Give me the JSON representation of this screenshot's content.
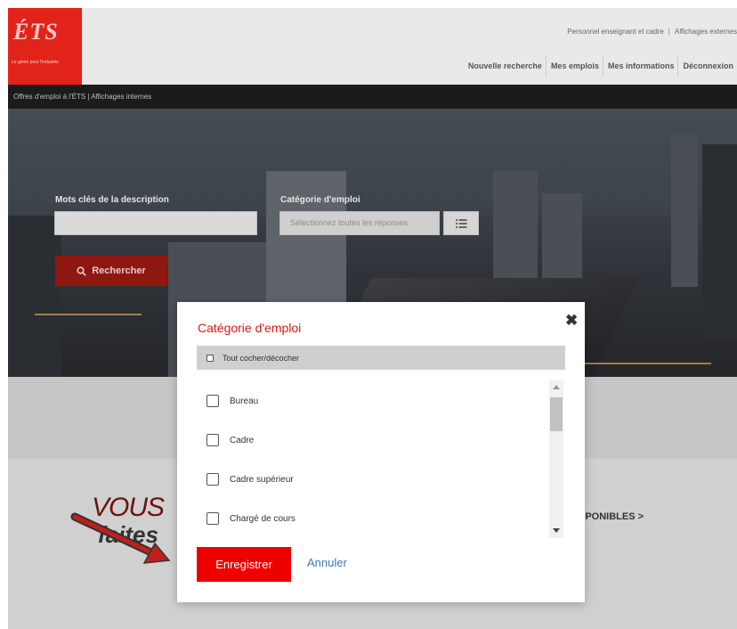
{
  "header": {
    "logo_mark": "ÉTS",
    "logo_tagline": "Le génie pour l'industrie",
    "top_links": [
      "Personnel enseignant et cadre",
      "Affichages externes"
    ],
    "top_links_separator": "|",
    "nav": [
      "Nouvelle recherche",
      "Mes emplois",
      "Mes informations",
      "Déconnexion"
    ]
  },
  "breadcrumb": "Offres d'emploi à l'ÉTS | Affichages internes",
  "search": {
    "keywords_label": "Mots clés de la description",
    "keywords_value": "",
    "category_label": "Catégorie d'emploi",
    "category_placeholder": "Sélectionnez toutes les réponses",
    "search_button": "Rechercher"
  },
  "banner": {
    "vous": "VOUS",
    "vous_sub": "faites",
    "link_text": "SPONIBLES >"
  },
  "modal": {
    "title": "Catégorie d'emploi",
    "close": "✖",
    "check_all": "Tout cocher/décocher",
    "options": [
      "Bureau",
      "Cadre",
      "Cadre supérieur",
      "Chargé de cours"
    ],
    "save": "Enregistrer",
    "cancel": "Annuler"
  },
  "colors": {
    "brand_red": "#e2231a",
    "save_red": "#ee0000",
    "title_red": "#d71a12",
    "link_blue": "#3c78b5"
  },
  "icons": [
    "list-icon",
    "search-icon",
    "close-icon",
    "red-arrow-icon"
  ]
}
